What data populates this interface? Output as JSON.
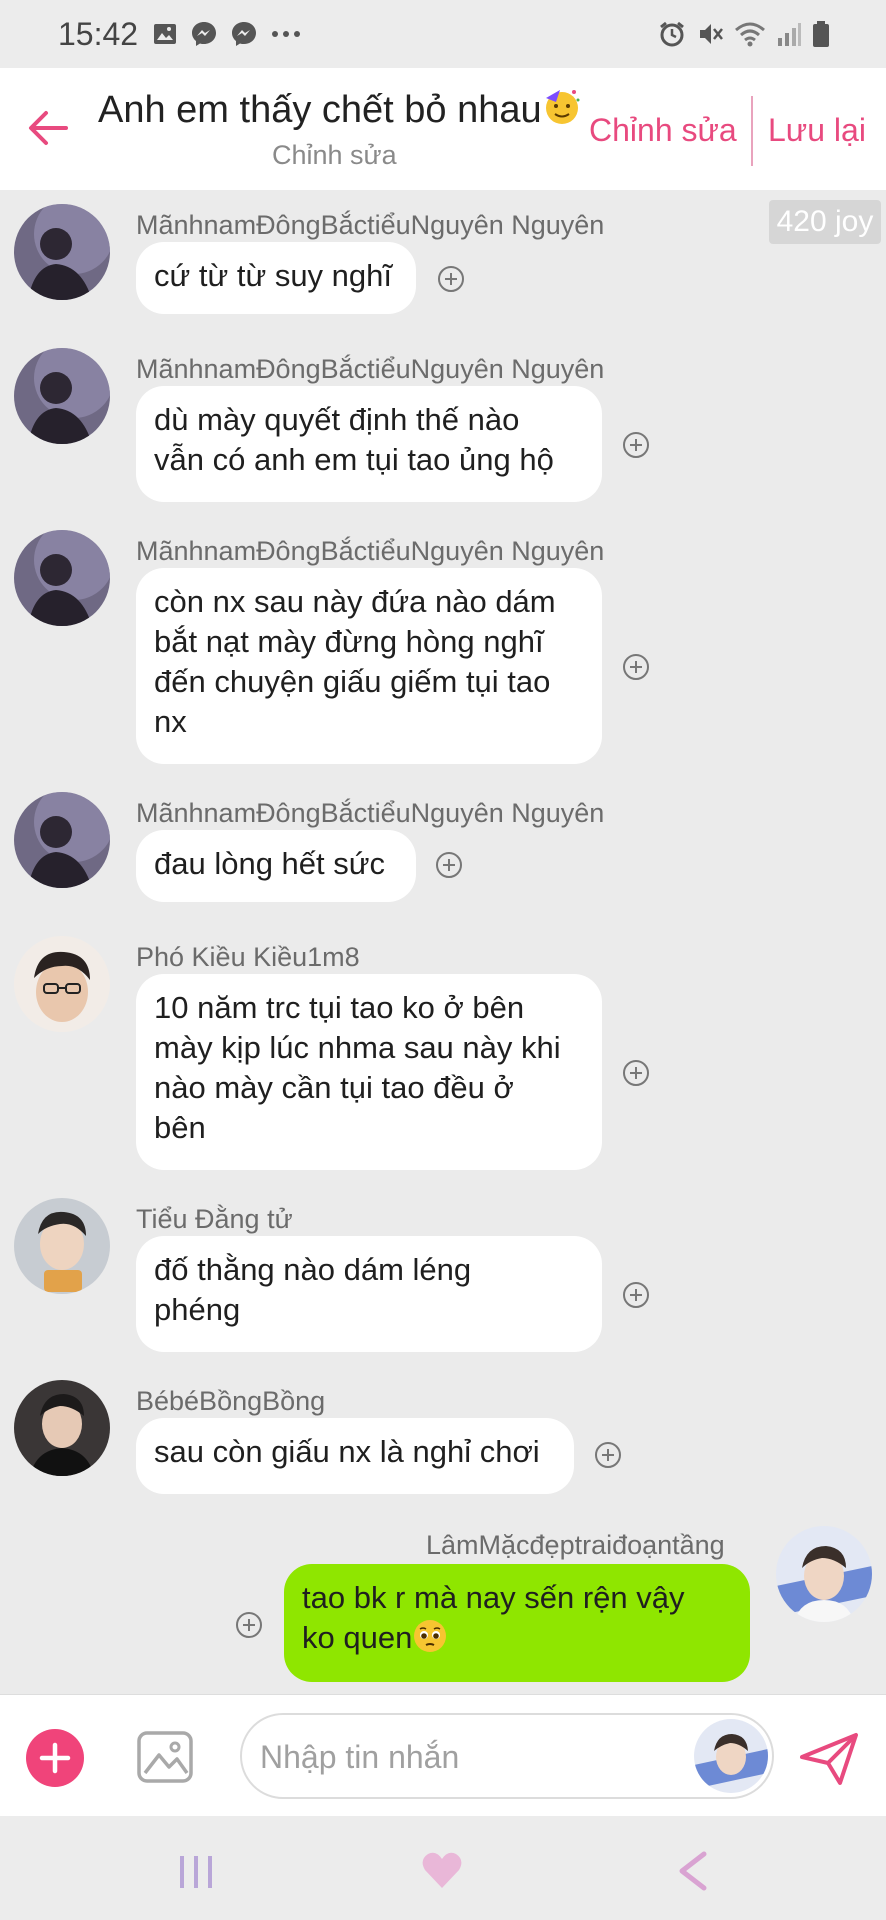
{
  "status": {
    "time": "15:42",
    "icons_left": [
      "image-icon",
      "messenger-icon",
      "messenger-icon",
      "more-dots-icon"
    ],
    "icons_right": [
      "alarm-icon",
      "mute-icon",
      "wifi-icon",
      "signal-icon",
      "battery-icon"
    ]
  },
  "header": {
    "title": "Anh em thấy chết bỏ nhau",
    "title_emoji": "party-face-emoji",
    "subtitle": "Chỉnh sửa",
    "edit_label": "Chỉnh sửa",
    "save_label": "Lưu lại",
    "accent": "#e84a7f"
  },
  "joy_badge": "420 joy",
  "messages": [
    {
      "sender": "MãnhnamĐôngBắctiểuNguyên Nguyên",
      "text": "cứ từ từ suy nghĩ"
    },
    {
      "sender": "MãnhnamĐôngBắctiểuNguyên Nguyên",
      "text": "dù mày quyết định thế nào\nvẫn có anh em tụi tao ủng hộ"
    },
    {
      "sender": "MãnhnamĐôngBắctiểuNguyên Nguyên",
      "text": "còn nx sau này đứa nào dám\nbắt nạt mày đừng hòng nghĩ\nđến chuyện giấu giếm tụi tao\nnx"
    },
    {
      "sender": "MãnhnamĐôngBắctiểuNguyên Nguyên",
      "text": "đau lòng hết sức"
    },
    {
      "sender": "Phó Kiều Kiều1m8",
      "text": "10 năm trc tụi tao ko ở bên\nmày kịp lúc nhma sau này khi\nnào mày cần tụi tao đều ở\nbên"
    },
    {
      "sender": "Tiểu Đằng tử",
      "text": "đố thằng nào dám léng\nphéng"
    },
    {
      "sender": "BébéBồngBồng",
      "text": "sau còn giấu nx là nghỉ chơi"
    },
    {
      "sender": "LâmMặcđẹptraiđoạntầng",
      "text": "tao bk r mà nay sến rện vậy\nko quen",
      "emoji": "pleading-face-emoji",
      "mine": true
    }
  ],
  "input": {
    "placeholder": "Nhập tin nhắn"
  },
  "colors": {
    "mine_bubble": "#8fe600",
    "other_bubble": "#ffffff",
    "background": "#ebebeb",
    "plus_button": "#f0447a"
  },
  "navbar": {
    "icons": [
      "recent-apps-icon",
      "home-heart-icon",
      "back-icon"
    ]
  }
}
